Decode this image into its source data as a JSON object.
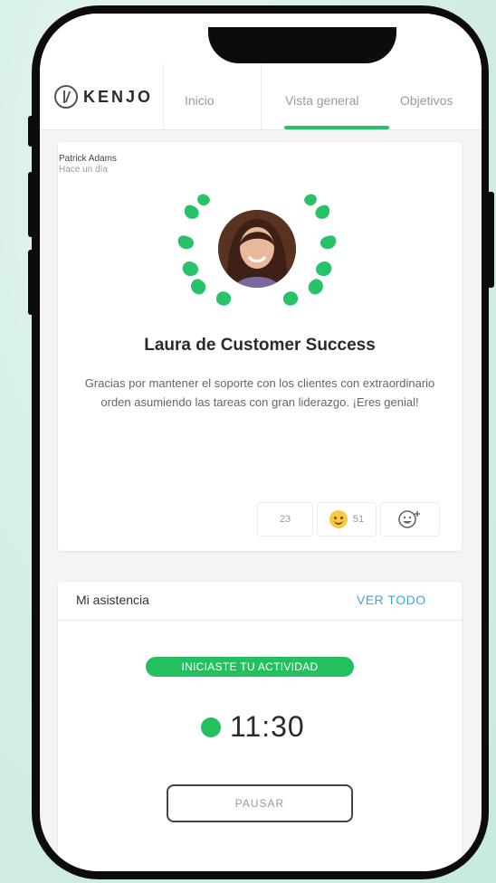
{
  "header": {
    "logo_text": "KENJO",
    "tabs": [
      {
        "label": "Inicio"
      },
      {
        "label": "Vista general"
      },
      {
        "label": "Objetivos"
      }
    ],
    "active_tab": "Vista general"
  },
  "post": {
    "author": "Patrick Adams",
    "time_ago": "Hace un día",
    "recipient_title": "Laura de Customer Success",
    "message": "Gracias por mantener el soporte con los clientes con extraordinario orden asumiendo las tareas con gran liderazgo. ¡Eres genial!",
    "reactions": [
      {
        "count": "23"
      },
      {
        "emoji": "smile-emoji",
        "count": "51"
      }
    ],
    "add_reaction_icon": "add-emoji-icon"
  },
  "attendance": {
    "title": "Mi asistencia",
    "see_all": "VER TODO",
    "status_badge": "INICIASTE TU ACTIVIDAD",
    "time": "11:30",
    "pause_label": "PAUSAR"
  },
  "colors": {
    "accent_green": "#23c05f",
    "link_blue": "#3aa6e8",
    "background": "#cfece3"
  }
}
